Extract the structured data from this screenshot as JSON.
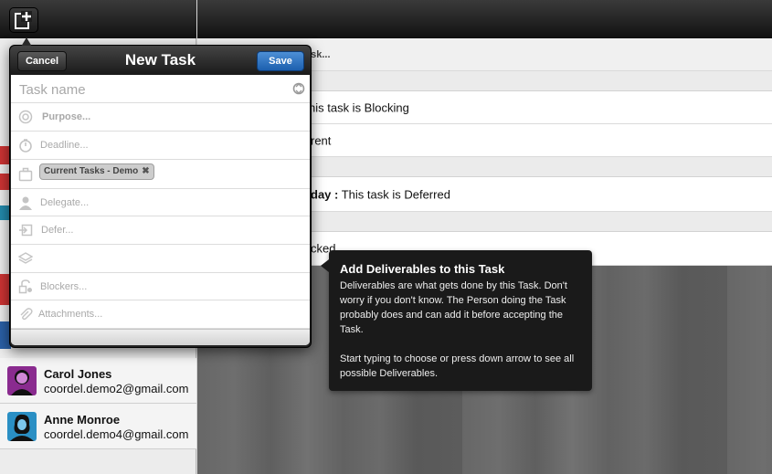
{
  "popover": {
    "title": "New Task",
    "cancel_label": "Cancel",
    "save_label": "Save",
    "task_name_placeholder": "Task name",
    "fields": {
      "purpose": "Purpose...",
      "deadline": "Deadline...",
      "project_tag": "Current Tasks - Demo",
      "delegate": "Delegate...",
      "defer": "Defer...",
      "deliverables": "",
      "blockers": "Blockers...",
      "attachments": "Attachments..."
    }
  },
  "tooltip": {
    "title": "Add Deliverables to this Task",
    "body_1": "Deliverables are what gets done by this Task. Don't worry if you don't know. The Person doing the Task probably does and can add it before accepting the Task.",
    "body_2": "Start typing to choose or press down arrow to see all possible Deliverables."
  },
  "task_list": {
    "row_1": "ask...",
    "row_2": "his task is Blocking",
    "row_3": "rent",
    "row_4_bold": "day :",
    "row_4_text": " This task is Deferred",
    "row_5": "cked"
  },
  "contacts": [
    {
      "name": "Carol Jones",
      "email": "coordel.demo2@gmail.com",
      "avatar_color": "#8a2b8f"
    },
    {
      "name": "Anne Monroe",
      "email": "coordel.demo4@gmail.com",
      "avatar_color": "#2a8fc4"
    }
  ],
  "colors": {
    "save_blue": "#2a6cbf",
    "tooltip_bg": "#1a1a1a",
    "header_dark": "#1a1a1a"
  }
}
